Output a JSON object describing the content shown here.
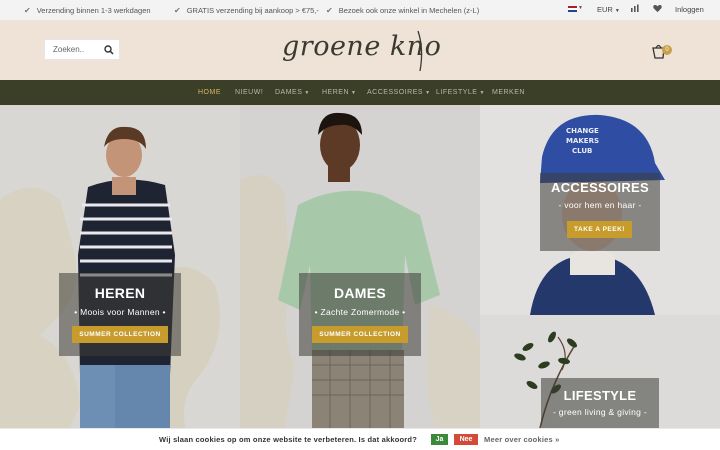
{
  "topbar": {
    "usps": [
      "Verzending binnen 1-3 werkdagen",
      "GRATIS verzending bij aankoop > €75,-",
      "Bezoek ook onze winkel in Mechelen (z-L)"
    ],
    "currency": "EUR",
    "login": "Inloggen"
  },
  "header": {
    "search_placeholder": "Zoeken..",
    "logo_text": "groene knoop.",
    "cart_count": "0"
  },
  "nav": {
    "items": [
      {
        "label": "HOME",
        "active": true
      },
      {
        "label": "NIEUW!"
      },
      {
        "label": "DAMES",
        "dropdown": true
      },
      {
        "label": "HEREN",
        "dropdown": true
      },
      {
        "label": "ACCESSOIRES",
        "dropdown": true
      },
      {
        "label": "LIFESTYLE",
        "dropdown": true
      },
      {
        "label": "MERKEN"
      }
    ]
  },
  "tiles": {
    "heren": {
      "title": "HEREN",
      "subtitle": "• Moois voor Mannen •",
      "button": "SUMMER COLLECTION"
    },
    "dames": {
      "title": "DAMES",
      "subtitle": "• Zachte Zomermode •",
      "button": "SUMMER COLLECTION"
    },
    "accessoires": {
      "title": "ACCESSOIRES",
      "subtitle": "- voor hem en haar -",
      "button": "TAKE A PEEK!",
      "cap_text": "CHANGE MAKERS CLUB"
    },
    "lifestyle": {
      "title": "LIFESTYLE",
      "subtitle": "- green living & giving -"
    }
  },
  "cookie": {
    "text": "Wij slaan cookies op om onze website te verbeteren. Is dat akkoord?",
    "yes": "Ja",
    "no": "Nee",
    "more": "Meer over cookies »"
  },
  "colors": {
    "nav_bg": "#3b3f27",
    "header_bg": "#efe3d8",
    "accent": "#c89c2c",
    "nav_active": "#d7b567",
    "cookie_yes": "#3b8a3b",
    "cookie_no": "#d24a3a"
  }
}
